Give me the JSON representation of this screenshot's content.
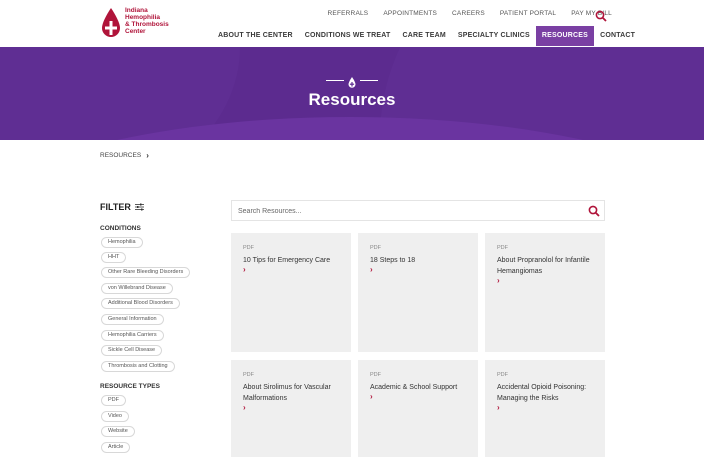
{
  "header": {
    "logo_lines": [
      "Indiana",
      "Hemophilia",
      "& Thrombosis",
      "Center"
    ],
    "utility_links": [
      "REFERRALS",
      "APPOINTMENTS",
      "CAREERS",
      "PATIENT PORTAL",
      "PAY MY BILL"
    ],
    "main_nav": [
      {
        "label": "ABOUT THE CENTER",
        "active": false
      },
      {
        "label": "CONDITIONS WE TREAT",
        "active": false
      },
      {
        "label": "CARE TEAM",
        "active": false
      },
      {
        "label": "SPECIALTY CLINICS",
        "active": false
      },
      {
        "label": "RESOURCES",
        "active": true
      },
      {
        "label": "CONTACT",
        "active": false
      }
    ]
  },
  "hero": {
    "title": "Resources"
  },
  "breadcrumb": {
    "items": [
      "RESOURCES"
    ]
  },
  "filter": {
    "title": "FILTER",
    "conditions_label": "CONDITIONS",
    "conditions": [
      "Hemophilia",
      "HHT",
      "Other Rare Bleeding Disorders",
      "von Willebrand Disease",
      "Additional Blood Disorders",
      "General Information",
      "Hemophilia Carriers",
      "Sickle Cell Disease",
      "Thrombosis and Clotting"
    ],
    "types_label": "RESOURCE TYPES",
    "types": [
      "PDF",
      "Video",
      "Website",
      "Article"
    ]
  },
  "search": {
    "placeholder": "Search Resources..."
  },
  "cards": [
    {
      "type": "PDF",
      "title": "10 Tips for Emergency Care"
    },
    {
      "type": "PDF",
      "title": "18 Steps to 18"
    },
    {
      "type": "PDF",
      "title": "About Propranolol for Infantile Hemangiomas"
    },
    {
      "type": "PDF",
      "title": "About Sirolimus for Vascular Malformations"
    },
    {
      "type": "PDF",
      "title": "Academic & School Support"
    },
    {
      "type": "PDF",
      "title": "Accidental Opioid Poisoning: Managing the Risks"
    }
  ],
  "colors": {
    "brand": "#b0143a",
    "purple": "#5c2b8f",
    "active_nav": "#7a3fa3"
  }
}
